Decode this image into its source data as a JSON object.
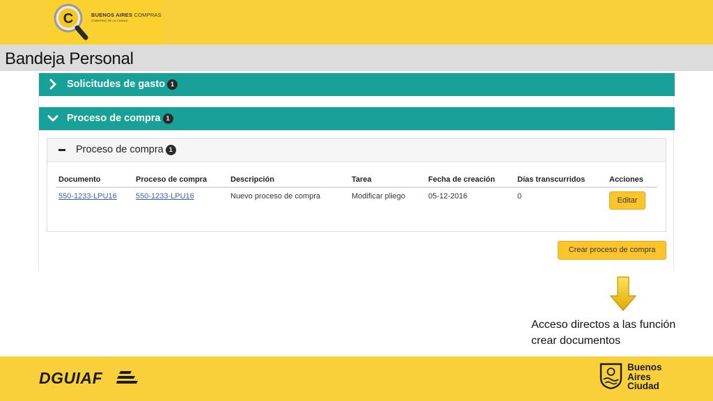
{
  "brand": {
    "logo_name_bold": "BUENOS AIRES",
    "logo_name_light": "COMPRAS",
    "logo_sub": "GOBIERNO DE LA CIUDAD"
  },
  "page_title": "Bandeja Personal",
  "sections": [
    {
      "label": "Solicitudes de gasto",
      "count": "1",
      "expanded": false
    },
    {
      "label": "Proceso de compra",
      "count": "1",
      "expanded": true
    }
  ],
  "inner_card": {
    "title": "Proceso de compra",
    "count": "1"
  },
  "table": {
    "headers": [
      "Documento",
      "Proceso de compra",
      "Descripción",
      "Tarea",
      "Fecha de creación",
      "Días transcurridos",
      "Acciones"
    ],
    "rows": [
      {
        "documento": "550-1233-LPU16",
        "proceso": "550-1233-LPU16",
        "descripcion": "Nuevo proceso de compra",
        "tarea": "Modificar pliego",
        "fecha": "05-12-2016",
        "dias": "0",
        "accion": "Editar"
      }
    ]
  },
  "create_button": "Crear proceso de compra",
  "note": "Acceso directos a las función crear documentos",
  "footer": {
    "left_brand": "DGUIAF",
    "right_line1": "Buenos",
    "right_line2": "Aires",
    "right_line3": "Ciudad"
  },
  "colors": {
    "yellow_band": "#f9d03a",
    "teal": "#17a199",
    "button_yellow": "#fdc52b",
    "link": "#3a63a8"
  },
  "icons": [
    "magnifier-logo-icon",
    "chevron-right-icon",
    "chevron-down-icon",
    "minus-icon",
    "down-arrow-icon",
    "city-emblem-icon"
  ]
}
